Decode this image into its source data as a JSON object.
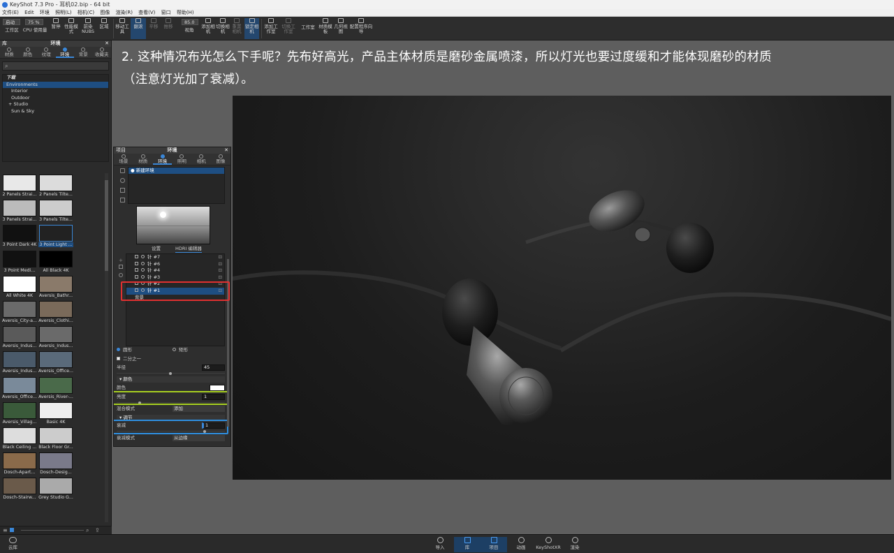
{
  "app": {
    "title": "KeyShot 7.3 Pro - 耳机02.bip - 64 bit"
  },
  "menu": [
    "文件(E)",
    "Edit",
    "环境",
    "照明(L)",
    "相机(C)",
    "图像",
    "渲染(R)",
    "查看(V)",
    "窗口",
    "帮助(H)"
  ],
  "toolbar": {
    "start_label": "启动",
    "zoom_value": "75 %",
    "items": [
      "工作区",
      "CPU 使用量",
      "暂停",
      "性能模式",
      "前染NUBS",
      "区域",
      "移动工具",
      "翻滚",
      "平移",
      "推移",
      "视角",
      "添加相机",
      "切换相机",
      "重置相机",
      "锁定相机",
      "添加工作室",
      "切换工作室",
      "工作室",
      "材质模板",
      "几何视图",
      "配置程序向导"
    ],
    "angle_value": "85.0"
  },
  "library": {
    "header": "库",
    "title": "环境",
    "tabs": [
      "材质",
      "颜色",
      "纹理",
      "环境",
      "背景",
      "收藏夹"
    ],
    "active_tab": "环境",
    "tree": {
      "root": "下载",
      "items": [
        "Environments",
        "Interior",
        "Outdoor",
        "Studio",
        "Sun & Sky"
      ],
      "selected": "Environments"
    },
    "thumbnails": [
      "2 Panels Strai...",
      "2 Panels Tilte...",
      "3 Panels Strai...",
      "3 Panels Tilte...",
      "3 Point Dark 4K",
      "3 Point Light ...",
      "3 Point Medi...",
      "All Black 4K",
      "All White 4K",
      "Aversis_Bathr...",
      "Aversis_City-a...",
      "Aversis_Clothi...",
      "Aversis_Indus...",
      "Aversis_Indus...",
      "Aversis_Indus...",
      "Aversis_Office...",
      "Aversis_Office...",
      "Aversis_River-...",
      "Aversis_Villag...",
      "Basic 4K",
      "Black Ceiling ...",
      "Black Floor Gr...",
      "Dosch-Apart...",
      "Dosch-Desig...",
      "Dosch-Stairw...",
      "Grey Studio G..."
    ],
    "selected_thumbnail": "3 Point Light ..."
  },
  "project": {
    "header": "项目",
    "title": "环境",
    "tabs": [
      "场景",
      "材质",
      "环境",
      "照明",
      "相机",
      "图像"
    ],
    "active_tab": "环境",
    "env_name": "新建环境",
    "subtabs": [
      "设置",
      "HDRI 编辑器"
    ],
    "pins": [
      "针 #7",
      "针 #6",
      "针 #4",
      "针 #3",
      "针 #2",
      "针 #1"
    ],
    "selected_pin": "针 #1",
    "background_label": "背景",
    "shape_options": [
      "圆形",
      "矩形"
    ],
    "half_label": "二分之一",
    "radius_label": "半径",
    "radius_value": "45",
    "color_section": "颜色",
    "color_label": "颜色",
    "brightness_label": "亮度",
    "brightness_value": "1",
    "blend_label": "混合模式",
    "blend_value": "添加",
    "adjust_section": "调节",
    "falloff_label": "衰减",
    "falloff_value": "1",
    "falloff_mode_label": "衰减模式",
    "falloff_mode_value": "从边缘"
  },
  "caption": {
    "line1": "2. 这种情况布光怎么下手呢？先布好高光，产品主体材质是磨砂金属喷漆，所以灯光也要过度缓和才能体现磨砂的材质",
    "line2": "（注意灯光加了衰减）。"
  },
  "annotations": {
    "pin_color": "#e03030",
    "brightness_color": "#a8d020",
    "falloff_color": "#2f8fe0"
  },
  "bottombar": {
    "cloud_label": "云库",
    "items": [
      "导入",
      "库",
      "项目",
      "动画",
      "KeyShotXR",
      "渲染"
    ],
    "active": [
      "库",
      "项目"
    ]
  }
}
